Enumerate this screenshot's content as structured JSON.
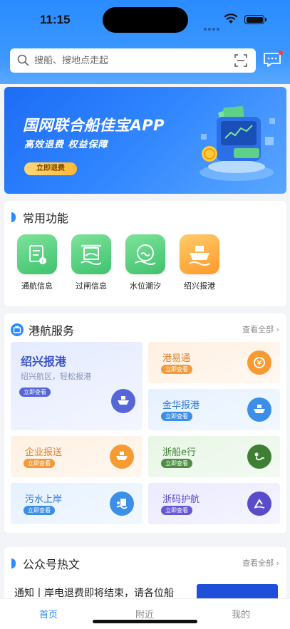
{
  "status": {
    "time": "11:15"
  },
  "search": {
    "placeholder": "搜船、搜地点走起"
  },
  "banner": {
    "title": "国网联合船佳宝APP",
    "subtitle": "高效退费  权益保障",
    "cta": "立即退费"
  },
  "common": {
    "title": "常用功能",
    "items": [
      {
        "label": "通航信息",
        "icon": "document-info-icon"
      },
      {
        "label": "过闸信息",
        "icon": "lock-gate-icon"
      },
      {
        "label": "水位潮汐",
        "icon": "water-level-icon"
      },
      {
        "label": "绍兴报港",
        "icon": "ship-report-icon"
      }
    ]
  },
  "port": {
    "title": "港航服务",
    "more": "查看全部",
    "featured": {
      "name": "绍兴报港",
      "desc": "绍兴航区，轻松报港",
      "btn": "立即查看"
    },
    "tiles": [
      {
        "name": "港易通",
        "btn": "立即查看"
      },
      {
        "name": "金华报港",
        "btn": "立即查看"
      },
      {
        "name": "企业报送",
        "btn": "立即查看"
      },
      {
        "name": "浙船e行",
        "btn": "立即查看"
      },
      {
        "name": "污水上岸",
        "btn": "立即查看"
      },
      {
        "name": "浙码护航",
        "btn": "立即查看"
      }
    ]
  },
  "articles": {
    "title": "公众号热文",
    "more": "查看全部",
    "first": "通知丨岸电退费即将结束，请各位船"
  },
  "nav": {
    "home": "首页",
    "nearby": "附近",
    "mine": "我的"
  },
  "colors": {
    "primary": "#2a8cff",
    "green": "#3fc26e",
    "orange": "#ff9a2a"
  }
}
